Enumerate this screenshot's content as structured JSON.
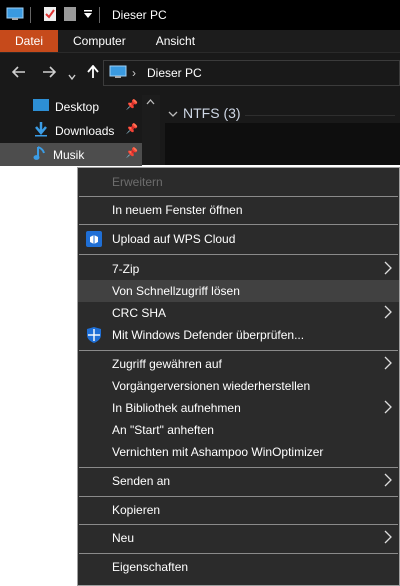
{
  "window": {
    "title": "Dieser PC",
    "ribbon_tabs": [
      "Datei",
      "Computer",
      "Ansicht"
    ],
    "address": "Dieser PC",
    "nav_items": [
      {
        "label": "Desktop",
        "icon": "desktop-folder-icon"
      },
      {
        "label": "Downloads",
        "icon": "download-arrow-icon"
      },
      {
        "label": "Musik",
        "icon": "music-note-icon"
      }
    ],
    "group_header": "NTFS (3)"
  },
  "context_menu": {
    "items": [
      {
        "label": "Erweitern",
        "disabled": true
      },
      {
        "label": "In neuem Fenster öffnen"
      },
      {
        "label": "Upload auf WPS Cloud",
        "icon": "wps-cloud-icon"
      },
      {
        "label": "7-Zip",
        "submenu": true
      },
      {
        "label": "Von Schnellzugriff lösen",
        "highlighted": true
      },
      {
        "label": "CRC SHA",
        "submenu": true
      },
      {
        "label": "Mit Windows Defender überprüfen...",
        "icon": "windows-defender-icon"
      },
      {
        "label": "Zugriff gewähren auf",
        "submenu": true
      },
      {
        "label": "Vorgängerversionen wiederherstellen"
      },
      {
        "label": "In Bibliothek aufnehmen",
        "submenu": true
      },
      {
        "label": "An \"Start\" anheften"
      },
      {
        "label": "Vernichten mit Ashampoo WinOptimizer"
      },
      {
        "label": "Senden an",
        "submenu": true
      },
      {
        "label": "Kopieren"
      },
      {
        "label": "Neu",
        "submenu": true
      },
      {
        "label": "Eigenschaften"
      }
    ]
  },
  "colors": {
    "accent": "#c64a1b",
    "menu_bg": "#2b2b2b",
    "window_bg": "#191919"
  }
}
